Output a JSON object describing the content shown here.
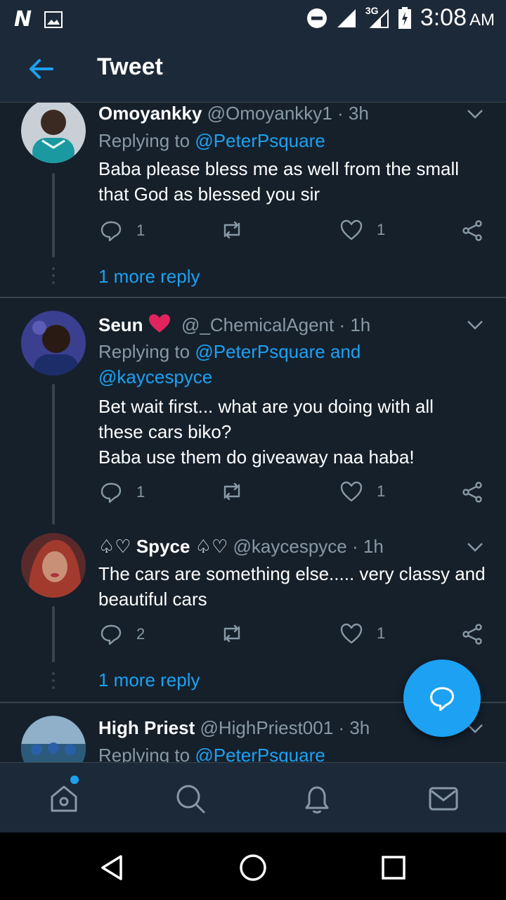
{
  "status_bar": {
    "time": "3:08",
    "ampm": "AM",
    "network": "3G",
    "icons": [
      "n-logo-icon",
      "image-icon",
      "do-not-disturb-icon",
      "signal-icon",
      "battery-icon"
    ]
  },
  "header": {
    "title": "Tweet",
    "back_icon": "arrow-left-icon"
  },
  "tweets": [
    {
      "name": "Omoyankky",
      "handle": "@Omoyankky1",
      "time": "· 3h",
      "reply_prefix": "Replying to ",
      "reply_to": "@PeterPsquare",
      "body": "Baba please bless me as well from the small that God as blessed you sir",
      "replies": "1",
      "retweets": "",
      "likes": "1",
      "more": "1 more reply"
    },
    {
      "name": "Seun",
      "handle": "@_ChemicalAgent",
      "time": "· 1h",
      "reply_prefix": "Replying to ",
      "reply_to": "@PeterPsquare and @kaycespyce",
      "body_lines": [
        "Bet wait first... what are you doing with all",
        "these cars biko?",
        "Baba use them do giveaway naa haba!"
      ],
      "replies": "1",
      "retweets": "",
      "likes": "1"
    },
    {
      "name": "♤♡ Spyce ♤♡",
      "handle": "@kaycespyce",
      "time": "· 1h",
      "body": "The cars are something else..... very classy and beautiful cars",
      "replies": "2",
      "retweets": "",
      "likes": "1",
      "more": "1 more reply"
    },
    {
      "name": "High Priest",
      "handle": "@HighPriest001",
      "time": "· 3h",
      "reply_prefix": "Replying to ",
      "reply_to": "@PeterPsquare"
    }
  ],
  "tab_bar": [
    "home-icon",
    "search-icon",
    "bell-icon",
    "mail-icon"
  ],
  "colors": {
    "background": "#15202b",
    "bar": "#1c2938",
    "accent": "#1da1f2",
    "secondary_text": "#8899a6",
    "divider": "#38444d",
    "heart": "#e0245e"
  }
}
